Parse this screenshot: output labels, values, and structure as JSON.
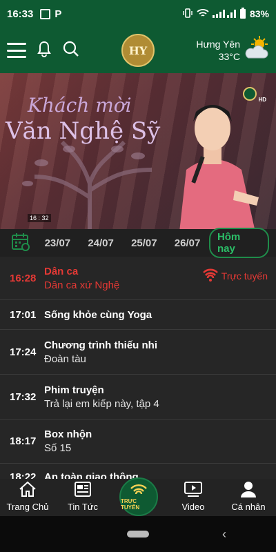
{
  "status_bar": {
    "time": "16:33",
    "battery": "83%"
  },
  "header": {
    "logo_text": "HY",
    "weather": {
      "city": "Hưng Yên",
      "temp": "33°C"
    }
  },
  "video": {
    "title_line1": "Khách mời",
    "title_line2": "Văn Nghệ Sỹ",
    "timestamp": "16 : 32",
    "badge": "HD"
  },
  "dates": [
    "23/07",
    "24/07",
    "25/07",
    "26/07"
  ],
  "today_label": "Hôm nay",
  "schedule": [
    {
      "time": "16:28",
      "program": "Dân ca",
      "subtitle": "Dân ca xứ Nghệ",
      "live": true,
      "live_label": "Trực tuyến"
    },
    {
      "time": "17:01",
      "program": "Sống khỏe cùng Yoga",
      "subtitle": ""
    },
    {
      "time": "17:24",
      "program": "Chương trình thiếu nhi",
      "subtitle": "Đoàn tàu"
    },
    {
      "time": "17:32",
      "program": "Phim truyện",
      "subtitle": "Trả lại em kiếp này, tập 4"
    },
    {
      "time": "18:17",
      "program": "Box nhộn",
      "subtitle": "Số 15"
    },
    {
      "time": "18:22",
      "program": "An toàn giao thông",
      "subtitle": ""
    }
  ],
  "bottom_nav": {
    "home": "Trang Chủ",
    "news": "Tin Tức",
    "live": "TRỰC TUYẾN",
    "video": "Video",
    "profile": "Cá nhân"
  },
  "colors": {
    "brand_green": "#0e5a32",
    "live_red": "#e53935",
    "accent_green": "#2bbd67"
  }
}
